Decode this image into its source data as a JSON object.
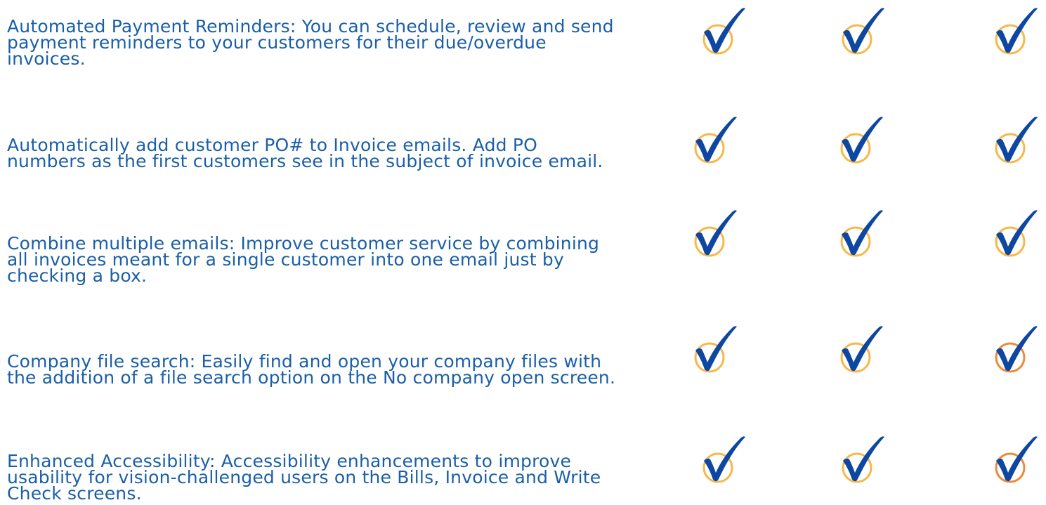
{
  "features": [
    {
      "text": "Automated Payment Reminders: You can schedule, review and send\npayment reminders to your customers for their due/overdue\ninvoices.",
      "checks": [
        {
          "icon": "checkmark-icon",
          "ring_color": "#f7b84a"
        },
        {
          "icon": "checkmark-icon",
          "ring_color": "#f7b84a"
        },
        {
          "icon": "checkmark-icon",
          "ring_color": "#f7b84a"
        }
      ]
    },
    {
      "text": "Automatically add customer PO# to Invoice emails. Add PO\nnumbers as the first customers see in the subject of invoice email.",
      "checks": [
        {
          "icon": "checkmark-icon",
          "ring_color": "#f7b84a"
        },
        {
          "icon": "checkmark-icon",
          "ring_color": "#f7b84a"
        },
        {
          "icon": "checkmark-icon",
          "ring_color": "#f7b84a"
        }
      ]
    },
    {
      "text": "Combine multiple emails: Improve customer service by combining\nall invoices meant for a single customer into one email just by\nchecking a box.",
      "checks": [
        {
          "icon": "checkmark-icon",
          "ring_color": "#f7b84a"
        },
        {
          "icon": "checkmark-icon",
          "ring_color": "#f7b84a"
        },
        {
          "icon": "checkmark-icon",
          "ring_color": "#f7b84a"
        }
      ]
    },
    {
      "text": "Company file search: Easily find and open your company files with\nthe addition of a file search option on the No company open screen.",
      "checks": [
        {
          "icon": "checkmark-icon",
          "ring_color": "#f7b84a"
        },
        {
          "icon": "checkmark-icon",
          "ring_color": "#f7b84a"
        },
        {
          "icon": "checkmark-icon",
          "ring_color": "#ef8a3c"
        }
      ]
    },
    {
      "text": "Enhanced Accessibility: Accessibility enhancements to improve\nusability for vision-challenged users on the Bills, Invoice and Write\nCheck screens.",
      "checks": [
        {
          "icon": "checkmark-icon",
          "ring_color": "#f7b84a"
        },
        {
          "icon": "checkmark-icon",
          "ring_color": "#f7b84a"
        },
        {
          "icon": "checkmark-icon",
          "ring_color": "#ef8a3c"
        }
      ]
    }
  ],
  "colors": {
    "text": "#1a5fa8",
    "checkmark": "#0d47a1"
  }
}
